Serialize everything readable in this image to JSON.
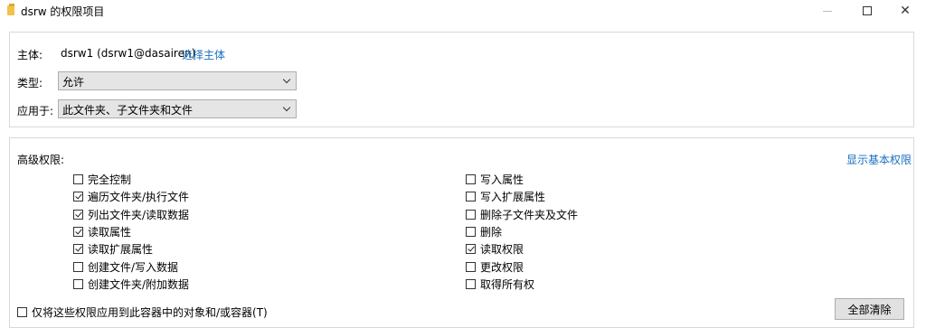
{
  "window": {
    "title": "dsrw 的权限项目",
    "minimize_icon": "minimize-icon",
    "maximize_icon": "maximize-icon",
    "close_icon": "close-icon",
    "close_glyph": "✕"
  },
  "principal": {
    "label": "主体:",
    "value": "dsrw1 (dsrw1@dasairen)",
    "select_link": "选择主体"
  },
  "type": {
    "label": "类型:",
    "selected": "允许"
  },
  "applies_to": {
    "label": "应用于:",
    "selected": "此文件夹、子文件夹和文件"
  },
  "advanced": {
    "label": "高级权限:",
    "show_basic_link": "显示基本权限",
    "left_column": [
      {
        "label": "完全控制",
        "checked": false
      },
      {
        "label": "遍历文件夹/执行文件",
        "checked": true
      },
      {
        "label": "列出文件夹/读取数据",
        "checked": true
      },
      {
        "label": "读取属性",
        "checked": true
      },
      {
        "label": "读取扩展属性",
        "checked": true
      },
      {
        "label": "创建文件/写入数据",
        "checked": false
      },
      {
        "label": "创建文件夹/附加数据",
        "checked": false
      }
    ],
    "right_column": [
      {
        "label": "写入属性",
        "checked": false
      },
      {
        "label": "写入扩展属性",
        "checked": false
      },
      {
        "label": "删除子文件夹及文件",
        "checked": false
      },
      {
        "label": "删除",
        "checked": false
      },
      {
        "label": "读取权限",
        "checked": true
      },
      {
        "label": "更改权限",
        "checked": false
      },
      {
        "label": "取得所有权",
        "checked": false
      }
    ]
  },
  "apply_only": {
    "label": "仅将这些权限应用到此容器中的对象和/或容器(T)",
    "checked": false
  },
  "clear_all_button": "全部清除"
}
